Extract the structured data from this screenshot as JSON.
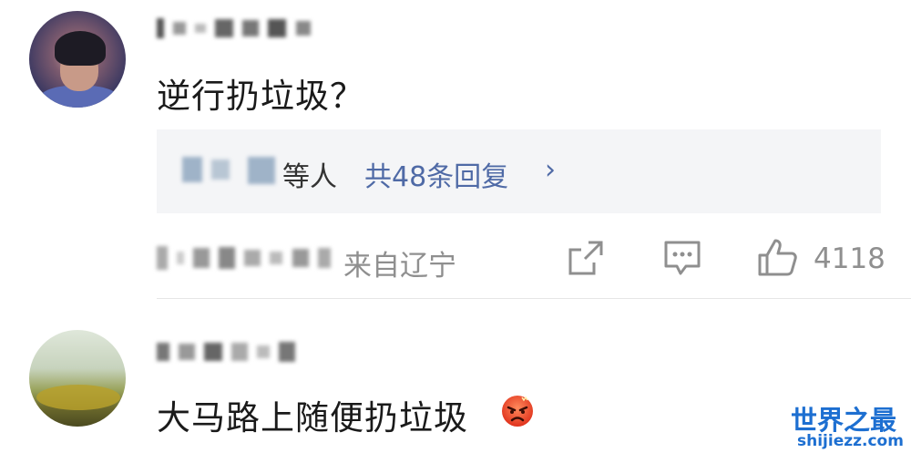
{
  "comments": [
    {
      "text": "逆行扔垃圾？",
      "reply_preview": {
        "suffix": "等人",
        "link": "共48条回复",
        "chevron": "›"
      },
      "meta": {
        "location": "来自辽宁",
        "like_count": "4118"
      }
    },
    {
      "text": "大马路上随便扔垃圾"
    }
  ],
  "watermark": {
    "title": "世界之最",
    "url": "shijiezz.com",
    "color": "#1d6fd1"
  },
  "icons": [
    "share-icon",
    "comment-icon",
    "like-icon",
    "angry-emoji"
  ],
  "colors": {
    "link": "#4f6aa6",
    "secondary_text": "#8f8f8f",
    "reply_bg": "#f4f5f7"
  }
}
